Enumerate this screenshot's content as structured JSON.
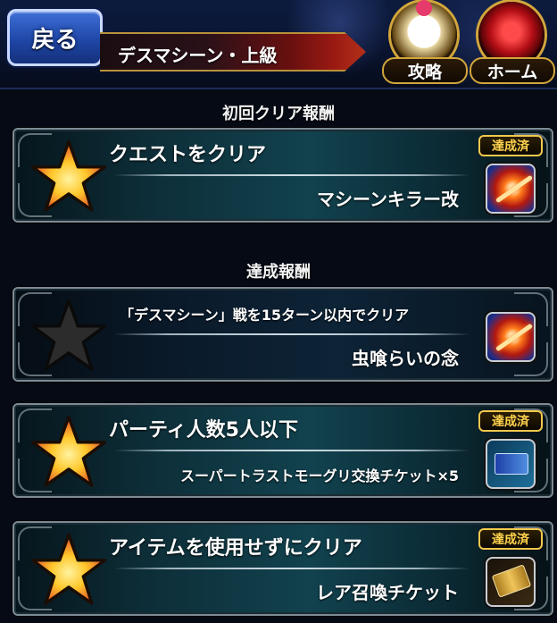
{
  "header": {
    "back_label": "戻る",
    "title": "デスマシーン・上級",
    "strategy_label": "攻略",
    "home_label": "ホーム"
  },
  "sections": {
    "first_clear": "初回クリア報酬",
    "achievement": "達成報酬"
  },
  "cards": [
    {
      "condition": "クエストをクリア",
      "reward": "マシーンキラー改",
      "completed": true,
      "badge": "達成済",
      "star": "gold",
      "item_icon": "weapon-icon"
    },
    {
      "condition": "「デスマシーン」戦を15ターン以内でクリア",
      "reward": "虫喰らいの念",
      "completed": false,
      "badge": "",
      "star": "dark",
      "item_icon": "weapon-icon"
    },
    {
      "condition": "パーティ人数5人以下",
      "reward": "スーパートラストモーグリ交換チケット×5",
      "completed": true,
      "badge": "達成済",
      "star": "gold",
      "item_icon": "ticket-icon"
    },
    {
      "condition": "アイテムを使用せずにクリア",
      "reward": "レア召喚チケット",
      "completed": true,
      "badge": "達成済",
      "star": "gold",
      "item_icon": "gold-ticket-icon"
    }
  ],
  "colors": {
    "star_gold_outer": "#e0452a",
    "star_gold_inner": "#ffd84a",
    "star_dark": "#2a2a2a",
    "badge_text": "#ffd24d",
    "badge_border": "#f2c94c"
  }
}
